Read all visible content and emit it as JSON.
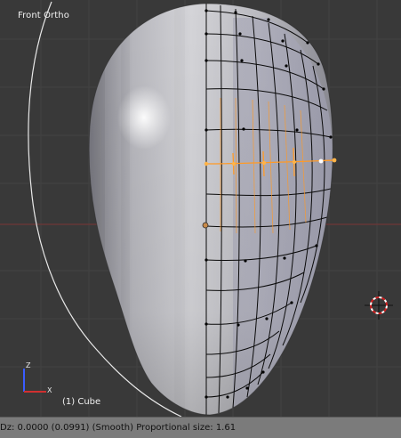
{
  "viewport": {
    "view_name": "Front Ortho",
    "object_name": "(1) Cube",
    "axis_labels": {
      "z": "Z",
      "x": "X"
    },
    "colors": {
      "background": "#393939",
      "grid_line": "#444444",
      "x_axis": "#7a3a3a",
      "selection": "#ff9f2a",
      "wire": "#000000",
      "proportional_circle": "#f0f0f0"
    }
  },
  "status_bar": {
    "text": "Dz: 0.0000 (0.0991) (Smooth)  Proportional size: 1.61"
  },
  "icons": [
    "3d-cursor-icon",
    "axis-gizmo-icon"
  ]
}
